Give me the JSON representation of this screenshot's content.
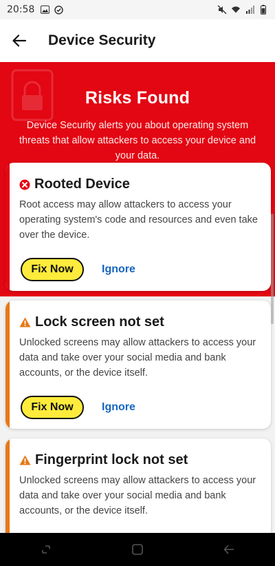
{
  "status_bar": {
    "time": "20:58",
    "left_icons": [
      "image-icon",
      "check-circle-icon"
    ],
    "right_icons": [
      "mute-icon",
      "wifi-icon",
      "signal-icon",
      "battery-icon"
    ]
  },
  "app_bar": {
    "title": "Device Security"
  },
  "hero": {
    "title": "Risks Found",
    "description": "Device Security alerts you about operating system threats that allow attackers to access your device and your data."
  },
  "colors": {
    "brand_red": "#e30613",
    "warning_orange": "#e77817",
    "fix_yellow": "#ffeb3b",
    "link_blue": "#1565c0"
  },
  "risks": [
    {
      "severity": "error",
      "title": "Rooted Device",
      "description": "Root access may allow attackers to access your operating system's code and resources and even take over the device.",
      "fix_label": "Fix Now",
      "ignore_label": "Ignore"
    },
    {
      "severity": "warning",
      "title": "Lock screen not set",
      "description": "Unlocked screens may allow attackers to access your data and take over your social media and bank accounts, or the device itself.",
      "fix_label": "Fix Now",
      "ignore_label": "Ignore"
    },
    {
      "severity": "warning",
      "title": "Fingerprint lock not set",
      "description": "Unlocked screens may allow attackers to access your data and take over your social media and bank accounts, or the device itself."
    }
  ],
  "nav_bar": {
    "buttons": [
      "recents-icon",
      "home-icon",
      "back-icon"
    ]
  }
}
